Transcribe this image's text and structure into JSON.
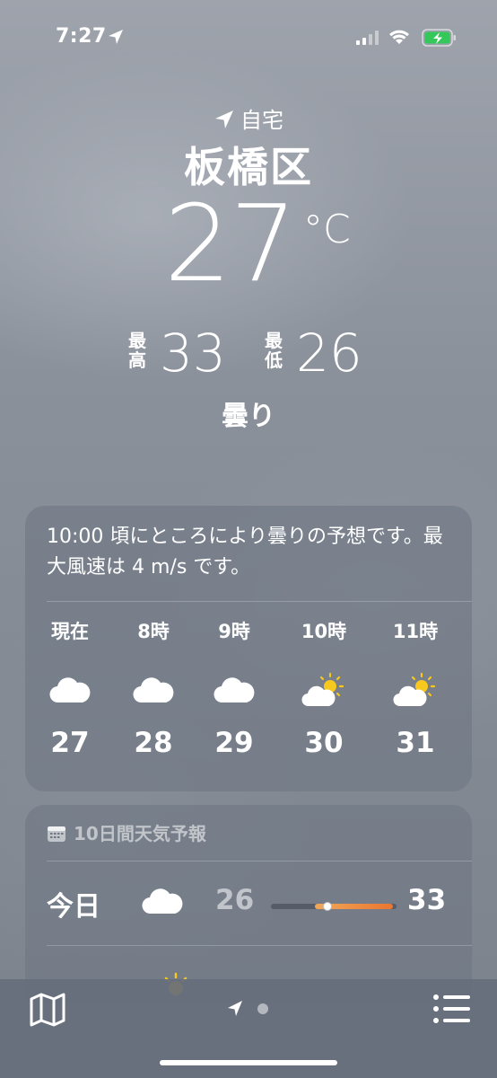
{
  "status_bar": {
    "time": "7:27",
    "location_icon": "location-arrow-icon",
    "signal_icon": "cellular-signal-icon",
    "wifi_icon": "wifi-icon",
    "battery_icon": "battery-charging-icon",
    "battery_color": "#34c759"
  },
  "location": {
    "label": "自宅",
    "city": "板橋区"
  },
  "current": {
    "temp": "27",
    "unit": "°C",
    "high_label": "最高",
    "high": "33",
    "low_label": "最低",
    "low": "26",
    "condition": "曇り"
  },
  "hourly": {
    "summary": "10:00 頃にところにより曇りの予想です。最大風速は 4 m/s です。",
    "hours": [
      {
        "label": "現在",
        "icon": "cloud-icon",
        "temp": "27"
      },
      {
        "label": "8時",
        "icon": "cloud-icon",
        "temp": "28"
      },
      {
        "label": "9時",
        "icon": "cloud-icon",
        "temp": "29"
      },
      {
        "label": "10時",
        "icon": "partly-sunny-icon",
        "temp": "30"
      },
      {
        "label": "11時",
        "icon": "partly-sunny-icon",
        "temp": "31"
      }
    ]
  },
  "daily": {
    "title": "10日間天気予報",
    "days": [
      {
        "name": "今日",
        "icon": "cloud-icon",
        "low": "26",
        "high": "33",
        "range_start": 0.35,
        "range_end": 0.97,
        "current_pos": 0.45
      }
    ]
  },
  "bottom_bar": {
    "map_icon": "map-icon",
    "list_icon": "list-icon"
  },
  "colors": {
    "range_fill_start": "#f0a85a",
    "range_fill_end": "#e9762f",
    "sun": "#f7c81e"
  }
}
